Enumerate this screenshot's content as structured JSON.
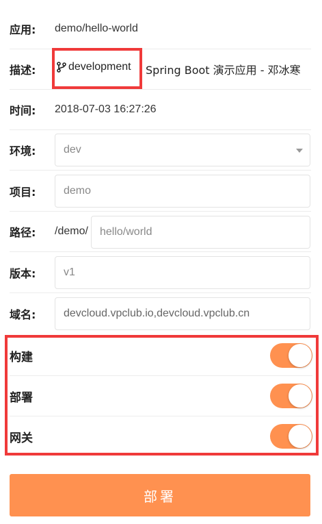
{
  "app": {
    "label": "应用:",
    "value": "demo/hello-world"
  },
  "desc": {
    "label": "描述:",
    "branch": "development",
    "text": "Spring Boot 演示应用 - 邓冰寒",
    "branch_icon": "git-branch-icon"
  },
  "time": {
    "label": "时间:",
    "value": "2018-07-03 16:27:26"
  },
  "env": {
    "label": "环境:",
    "value": "dev",
    "icon": "chevron-down-icon"
  },
  "project": {
    "label": "项目:",
    "value": "demo"
  },
  "path": {
    "label": "路径:",
    "prefix": "/demo/",
    "value": "hello/world"
  },
  "version": {
    "label": "版本:",
    "value": "v1"
  },
  "domain": {
    "label": "域名:",
    "value": "devcloud.vpclub.io,devcloud.vpclub.cn"
  },
  "toggles": [
    {
      "label": "构建",
      "on": true
    },
    {
      "label": "部署",
      "on": true
    },
    {
      "label": "网关",
      "on": true
    }
  ],
  "deploy_button": "部署",
  "colors": {
    "accent": "#ff9150",
    "highlight": "#f03a3a"
  }
}
